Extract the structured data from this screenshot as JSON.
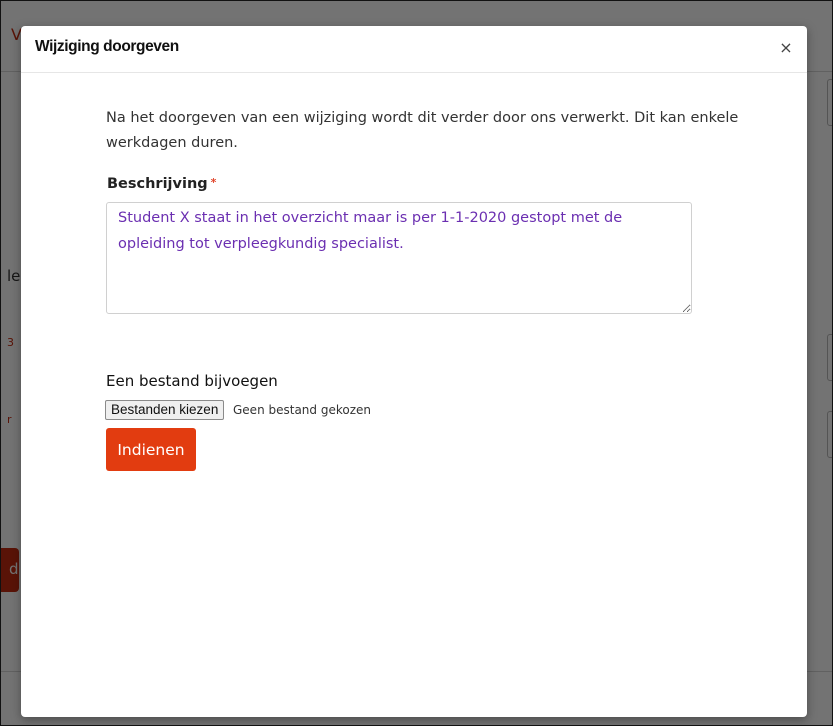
{
  "background": {
    "top_letter": "V",
    "side_letter_le": "le",
    "side_red_3": "3",
    "side_red_r": "r",
    "side_button_letter": "d"
  },
  "modal": {
    "title": "Wijziging doorgeven",
    "close_label": "×",
    "intro_text": "Na het doorgeven van een wijziging wordt dit verder door ons verwerkt. Dit kan enkele werkdagen duren.",
    "description": {
      "label": "Beschrijving",
      "required_mark": "*",
      "value": "Student X staat in het overzicht maar is per 1-1-2020 gestopt met de opleiding tot verpleegkundig specialist."
    },
    "upload": {
      "label": "Een bestand bijvoegen",
      "button_label": "Bestanden kiezen",
      "status": "Geen bestand gekozen"
    },
    "submit_label": "Indienen"
  },
  "colors": {
    "accent": "#e23c10",
    "input_text": "#6b2fb1",
    "required": "#e0442a"
  }
}
